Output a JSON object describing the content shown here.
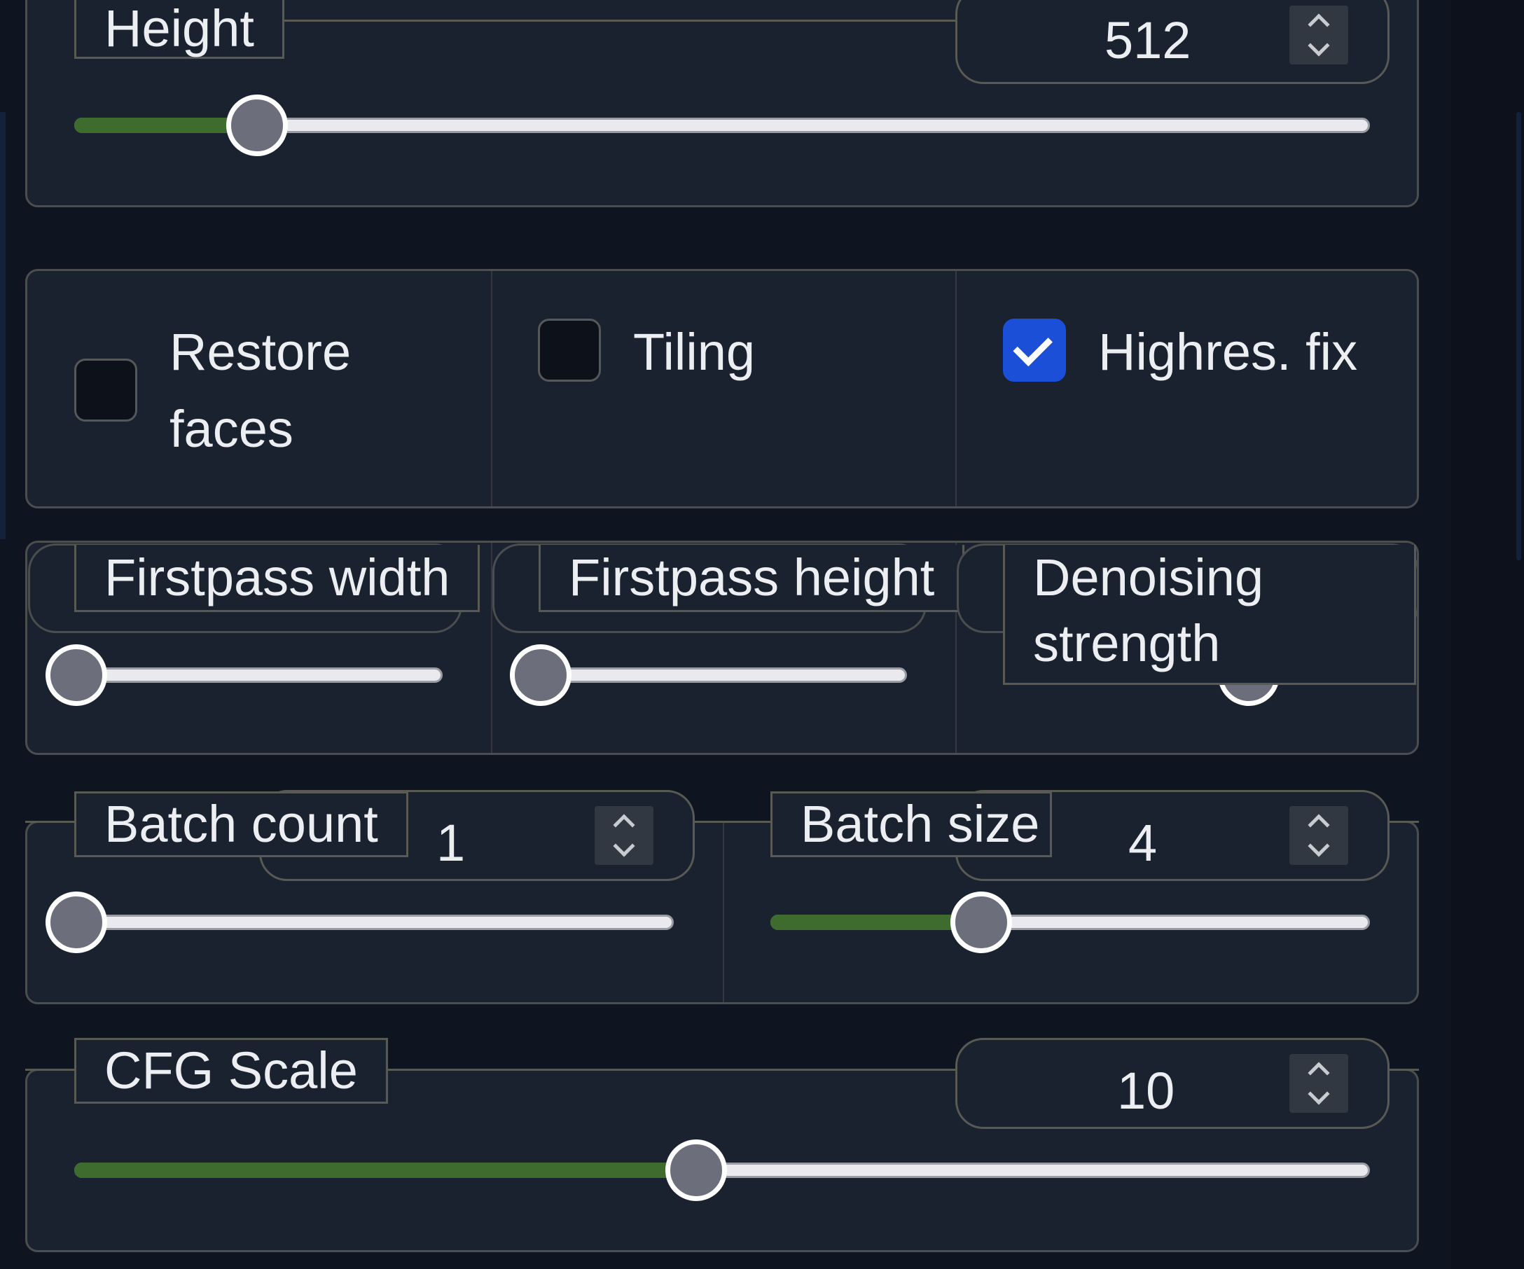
{
  "height_setting": {
    "label": "Height",
    "value": "512",
    "slider_fraction": 0.14
  },
  "toggles": {
    "restore_faces": {
      "label": "Restore faces",
      "checked": false
    },
    "tiling": {
      "label": "Tiling",
      "checked": false
    },
    "highres_fix": {
      "label": "Highres. fix",
      "checked": true
    }
  },
  "firstpass_width": {
    "label": "Firstpass width",
    "slider_fraction": 0.0
  },
  "firstpass_height": {
    "label": "Firstpass height",
    "slider_fraction": 0.0
  },
  "denoising_strength": {
    "label": "Denoising strength",
    "slider_fraction": 0.67
  },
  "batch_count": {
    "label": "Batch count",
    "value": "1",
    "slider_fraction": 0.0
  },
  "batch_size": {
    "label": "Batch size",
    "value": "4",
    "slider_fraction": 0.35
  },
  "cfg_scale": {
    "label": "CFG Scale",
    "value": "10",
    "slider_fraction": 0.48
  },
  "colors": {
    "accent_fill": "#3e6b2e",
    "checkbox_checked": "#1b4fd8",
    "panel_bg": "#1a2230",
    "page_bg": "#0e1420"
  },
  "icons": {
    "spinner": "up-down-chevrons",
    "checkmark": "check"
  }
}
